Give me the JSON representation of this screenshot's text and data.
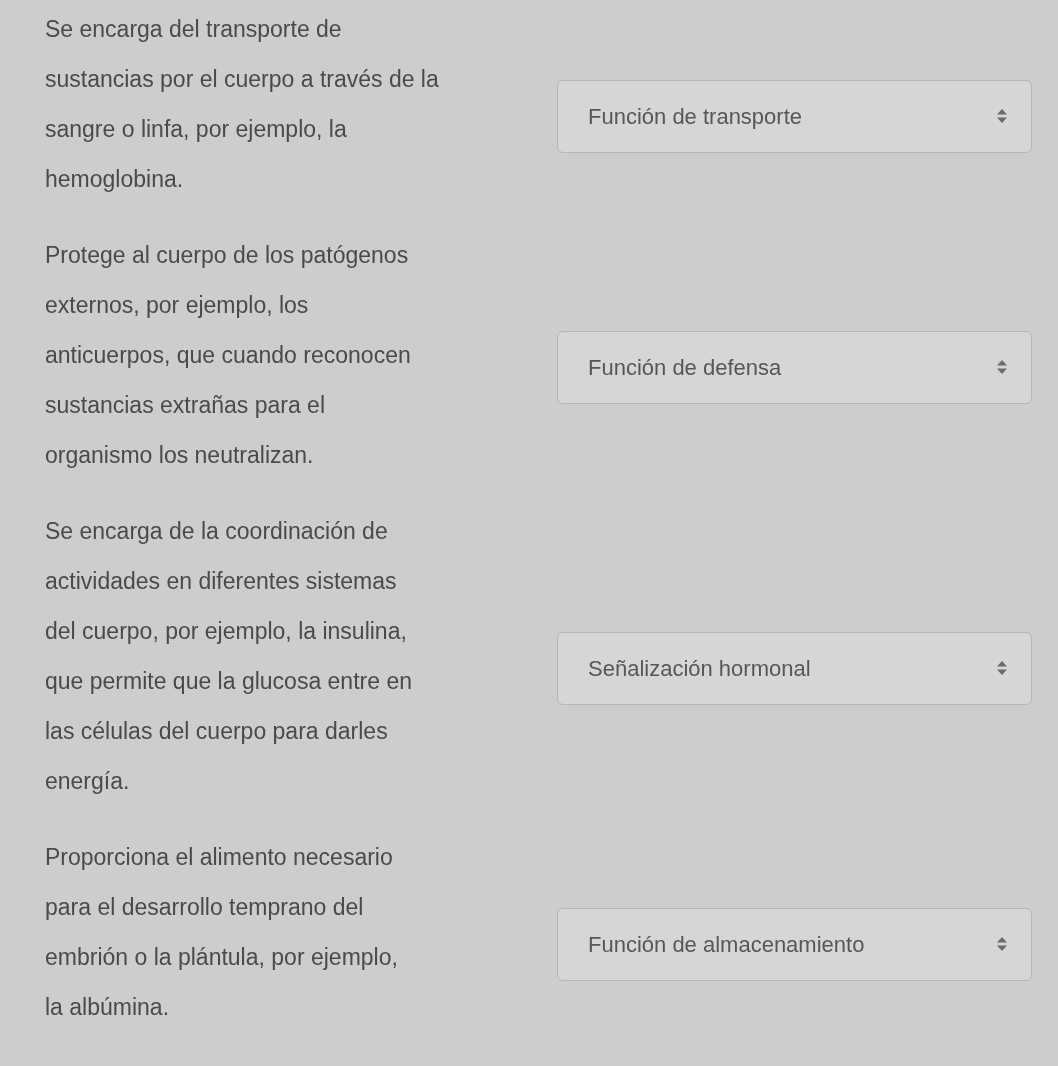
{
  "questions": [
    {
      "description_lines": [
        "Se encarga del transporte de",
        "sustancias por el cuerpo a través de la",
        "sangre o linfa, por ejemplo, la",
        "hemoglobina."
      ],
      "answer": "Función de transporte"
    },
    {
      "description_lines": [
        "Protege al cuerpo de los patógenos",
        "externos, por ejemplo, los",
        "anticuerpos, que cuando reconocen",
        "sustancias extrañas para el",
        "organismo los neutralizan."
      ],
      "answer": "Función de defensa"
    },
    {
      "description_lines": [
        "Se encarga de la coordinación de",
        "actividades en diferentes sistemas",
        "del cuerpo, por ejemplo, la insulina,",
        "que permite que la glucosa entre en",
        "las células del cuerpo para darles",
        "energía."
      ],
      "answer": "Señalización hormonal"
    },
    {
      "description_lines": [
        "Proporciona el alimento necesario",
        "para el desarrollo temprano del",
        "embrión o la plántula, por ejemplo,",
        "la albúmina."
      ],
      "answer": "Función de almacenamiento"
    }
  ]
}
